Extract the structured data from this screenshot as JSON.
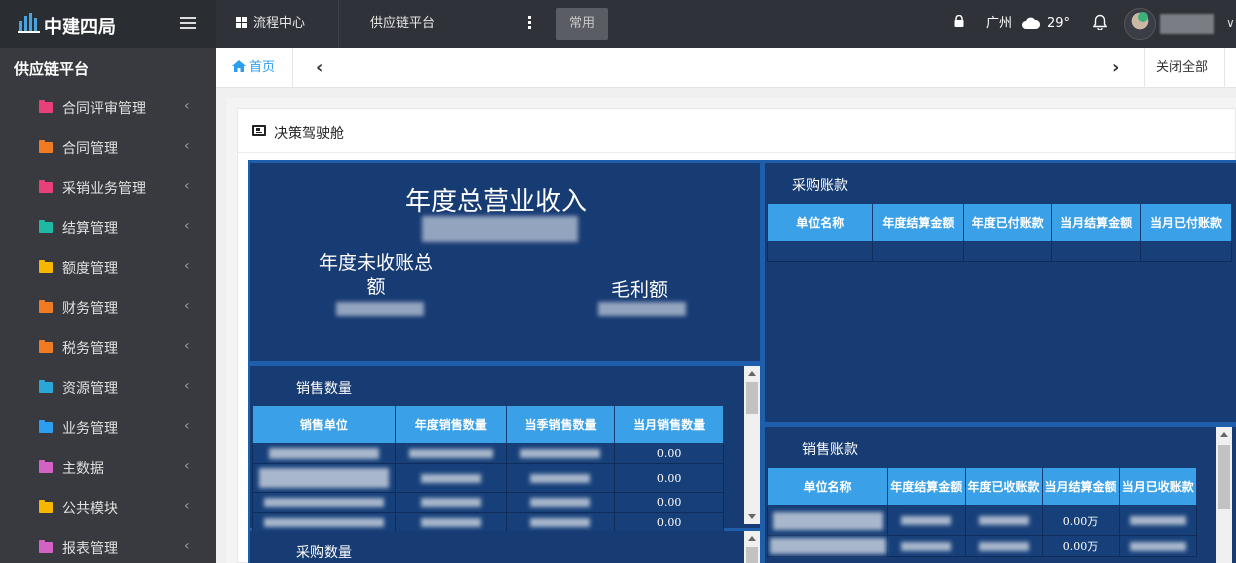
{
  "header": {
    "logo_text": "中建四局",
    "nav": [
      {
        "label": "流程中心"
      },
      {
        "label": "供应链平台"
      }
    ],
    "common_label": "常用",
    "city": "广州",
    "temperature": "29°",
    "icons": [
      "logo-icon",
      "menu-icon",
      "grid-icon",
      "more-icon",
      "lock-icon",
      "cloud-icon",
      "bell-icon",
      "chevron-down-icon"
    ]
  },
  "sidebar": {
    "title": "供应链平台",
    "items": [
      {
        "label": "合同评审管理",
        "color": "#e8417a"
      },
      {
        "label": "合同管理",
        "color": "#f07b22"
      },
      {
        "label": "采销业务管理",
        "color": "#e8417a"
      },
      {
        "label": "结算管理",
        "color": "#1fb8a4"
      },
      {
        "label": "额度管理",
        "color": "#f5b700"
      },
      {
        "label": "财务管理",
        "color": "#f07b22"
      },
      {
        "label": "税务管理",
        "color": "#f07b22"
      },
      {
        "label": "资源管理",
        "color": "#2aa7d6"
      },
      {
        "label": "业务管理",
        "color": "#2c9ef0"
      },
      {
        "label": "主数据",
        "color": "#d462c4"
      },
      {
        "label": "公共模块",
        "color": "#f5b700"
      },
      {
        "label": "报表管理",
        "color": "#d462c4"
      }
    ]
  },
  "tabs": {
    "home": "首页",
    "close_all": "关闭全部"
  },
  "panel": {
    "title": "决策驾驶舱"
  },
  "dashboard": {
    "revenue_title": "年度总营业收入",
    "unpaid_title": "年度未收账总额",
    "profit_title": "毛利额",
    "sales_qty": {
      "title": "销售数量",
      "headers": [
        "销售单位",
        "年度销售数量",
        "当季销售数量",
        "当月销售数量"
      ],
      "rows": [
        {
          "month": "0.00"
        },
        {
          "month": "0.00"
        },
        {
          "month": "0.00"
        },
        {
          "month": "0.00"
        }
      ]
    },
    "purchase_qty": {
      "title": "采购数量"
    },
    "purchase_ap": {
      "title": "采购账款",
      "headers": [
        "单位名称",
        "年度结算金额",
        "年度已付账款",
        "当月结算金额",
        "当月已付账款"
      ]
    },
    "sales_ar": {
      "title": "销售账款",
      "headers": [
        "单位名称",
        "年度结算金额",
        "年度已收账款",
        "当月结算金额",
        "当月已收账款"
      ],
      "rows": [
        {
          "month_settle": "0.00万"
        },
        {
          "month_settle": "0.00万"
        }
      ]
    }
  },
  "colors": {
    "topbar": "#2f3238",
    "sidebar": "#383a3f",
    "dashboard_border": "#1e5eab",
    "card_bg": "#173b73",
    "table_header": "#3aa0e8",
    "accent": "#2c9ef0"
  }
}
